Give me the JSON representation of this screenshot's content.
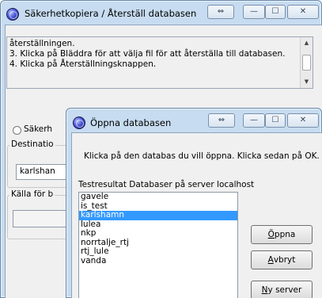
{
  "backup_window": {
    "title": "Säkerhetkopiera / Återställ databasen",
    "instructions": [
      "återställningen.",
      "3. Klicka på Bläddra för att välja fil för att återställa till databasen.",
      "4. Klicka på Återställningsknappen."
    ],
    "radio_label": "Säkerh",
    "destination_label": "Destinatio",
    "destination_value": "karlshan",
    "source_label": "Källa för b"
  },
  "open_dialog": {
    "title": "Öppna databasen",
    "prompt": "Klicka på den databas du vill öppna. Klicka sedan på OK.",
    "list_header": "Testresultat Databaser på server localhost",
    "databases": [
      "gavele",
      "is_test",
      "karlshamn",
      "lulea",
      "nkp",
      "norrtalje_rtj",
      "rtj_lule",
      "vanda"
    ],
    "selected_database": "karlshamn",
    "open_button": {
      "first": "Ö",
      "rest": "ppna"
    },
    "cancel_button": {
      "first": "A",
      "rest": "vbryt"
    },
    "new_server_button": {
      "first": "N",
      "rest": "y server"
    }
  },
  "window_controls": {
    "resize_glyph": "⇔",
    "minimize_glyph": "—",
    "maximize_glyph": "☐",
    "close_glyph": "✕"
  },
  "colors": {
    "titlebar_bg": "#c7dcf0",
    "selection": "#3399ff",
    "face": "#f0f0f0"
  },
  "icons": [
    "app-database-icon",
    "resize-icon",
    "minimize-icon",
    "maximize-icon",
    "close-icon",
    "scroll-up-icon",
    "scroll-down-icon"
  ]
}
